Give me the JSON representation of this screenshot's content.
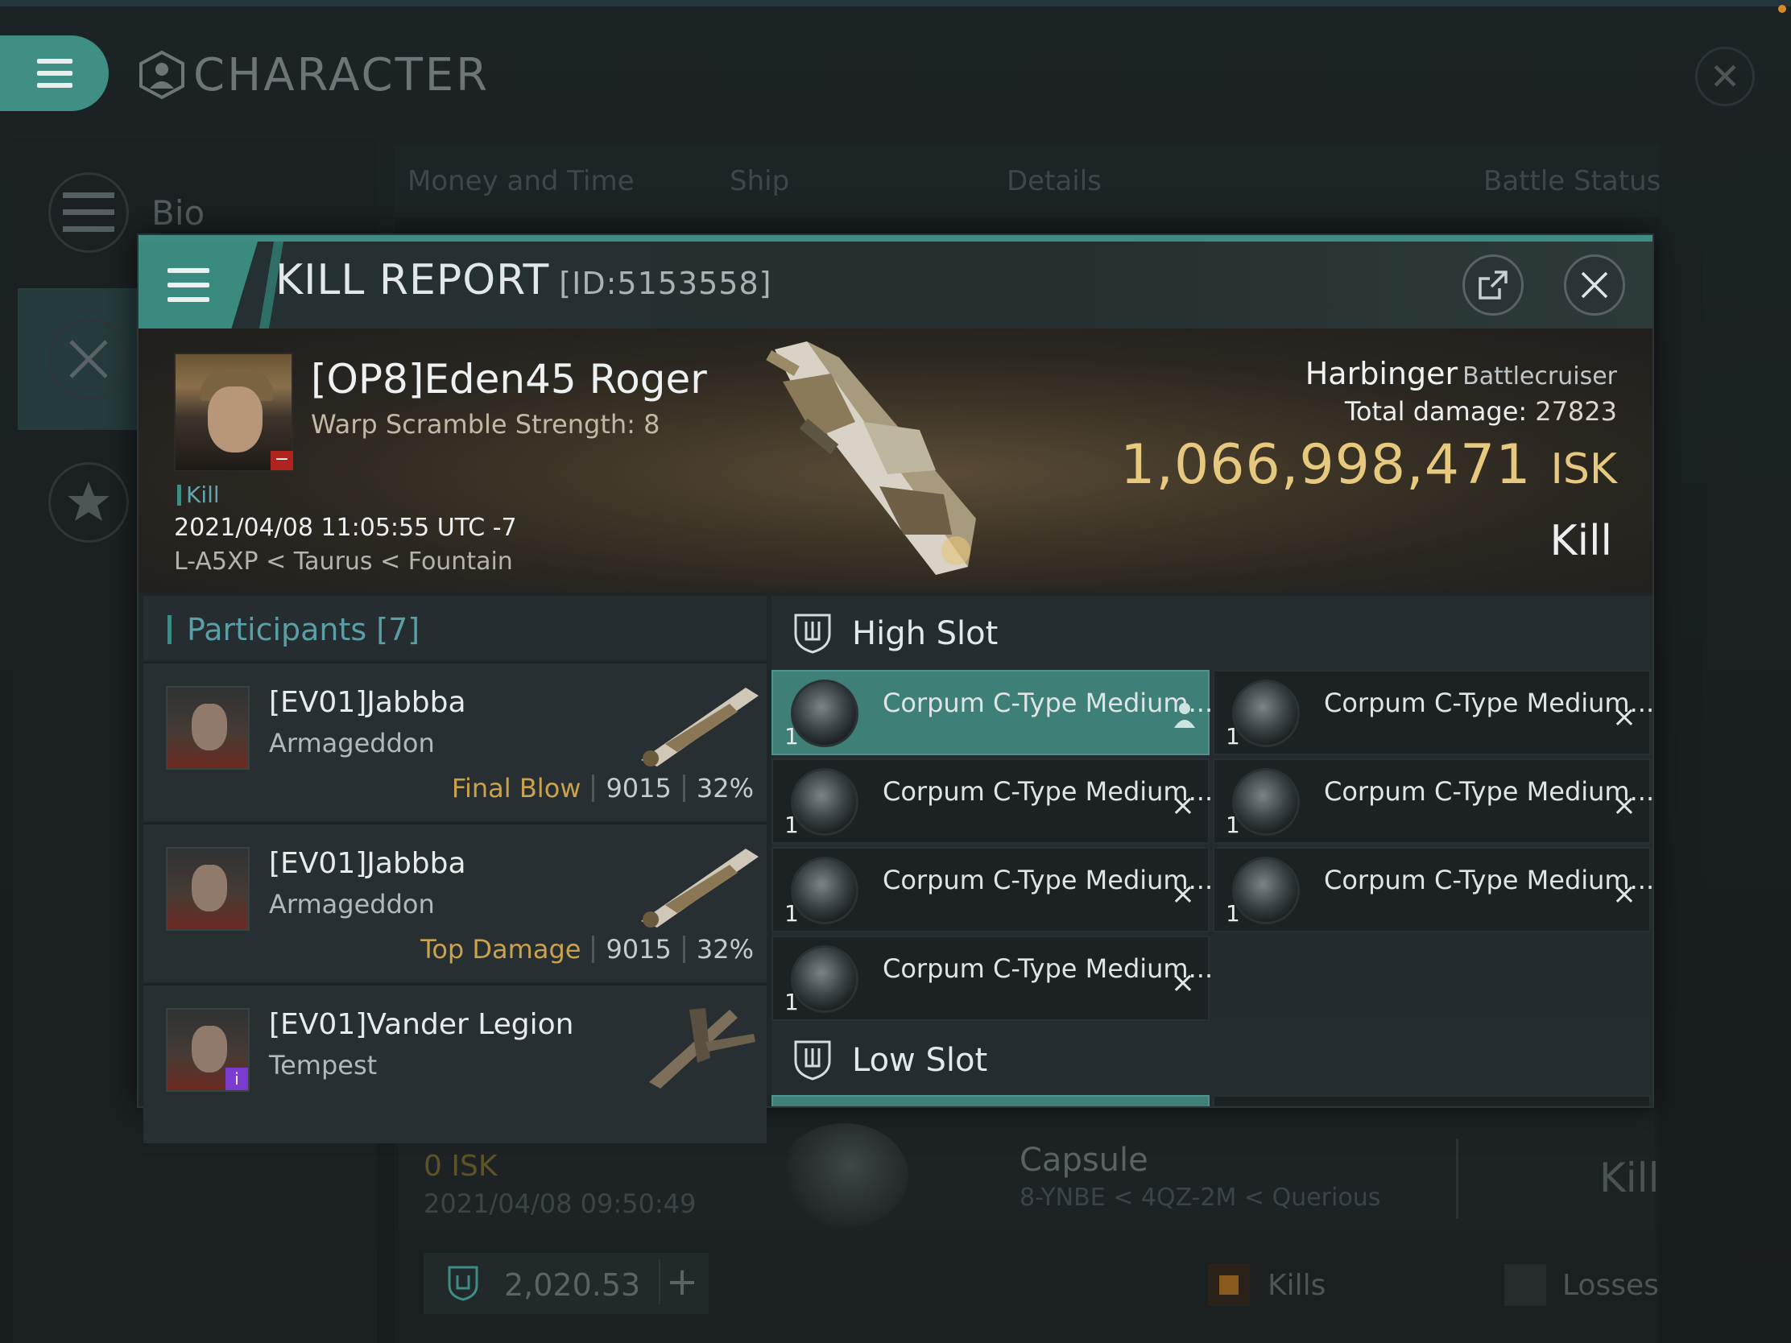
{
  "window": {
    "title": "CHARACTER",
    "sidebar": {
      "bio_label": "Bio"
    },
    "tabs": [
      "Money and Time",
      "Ship",
      "Details",
      "Battle Status"
    ]
  },
  "modal": {
    "title": "KILL REPORT",
    "report_id": "[ID:5153558]"
  },
  "victim": {
    "name": "[OP8]Eden45 Roger",
    "warp_scramble": "Warp Scramble Strength: 8",
    "kill_tag": "Kill",
    "datetime": "2021/04/08 11:05:55 UTC -7",
    "location": "L-A5XP < Taurus < Fountain",
    "ship_name": "Harbinger",
    "ship_class": "Battlecruiser",
    "total_damage_label": "Total damage:",
    "total_damage": "27823",
    "isk_value": "1,066,998,471",
    "isk_unit": "ISK",
    "result": "Kill"
  },
  "participants": {
    "header": "Participants [7]",
    "rows": [
      {
        "name": "[EV01]Jabbba",
        "ship": "Armageddon",
        "role": "Final Blow",
        "damage": "9015",
        "percent": "32%"
      },
      {
        "name": "[EV01]Jabbba",
        "ship": "Armageddon",
        "role": "Top Damage",
        "damage": "9015",
        "percent": "32%"
      },
      {
        "name": "[EV01]Vander Legion",
        "ship": "Tempest",
        "role": "",
        "damage": "",
        "percent": ""
      }
    ]
  },
  "fittings": {
    "high_slot_label": "High Slot",
    "low_slot_label": "Low Slot",
    "high_modules": [
      {
        "name": "Corpum C-Type Medium...",
        "qty": "1",
        "state": "dropped"
      },
      {
        "name": "Corpum C-Type Medium...",
        "qty": "1",
        "state": "destroyed"
      },
      {
        "name": "Corpum C-Type Medium...",
        "qty": "1",
        "state": "destroyed"
      },
      {
        "name": "Corpum C-Type Medium...",
        "qty": "1",
        "state": "destroyed"
      },
      {
        "name": "Corpum C-Type Medium...",
        "qty": "1",
        "state": "destroyed"
      },
      {
        "name": "Corpum C-Type Medium...",
        "qty": "1",
        "state": "destroyed"
      },
      {
        "name": "Corpum C-Type Medium...",
        "qty": "1",
        "state": "destroyed"
      }
    ],
    "destroyed_mark": "×"
  },
  "background_list": {
    "isk": "0  ISK",
    "date": "2021/04/08  09:50:49",
    "ship": "Capsule",
    "location": "8-YNBE < 4QZ-2M < Querious",
    "result": "Kill"
  },
  "footer": {
    "value": "2,020.53",
    "kills_label": "Kills",
    "losses_label": "Losses",
    "kills_color": "#8a5a1e",
    "losses_color": "#262c2e"
  },
  "colors": {
    "accent": "#3e8c84",
    "isk_gold": "#e6c97f",
    "role_gold": "#c9a24d"
  }
}
